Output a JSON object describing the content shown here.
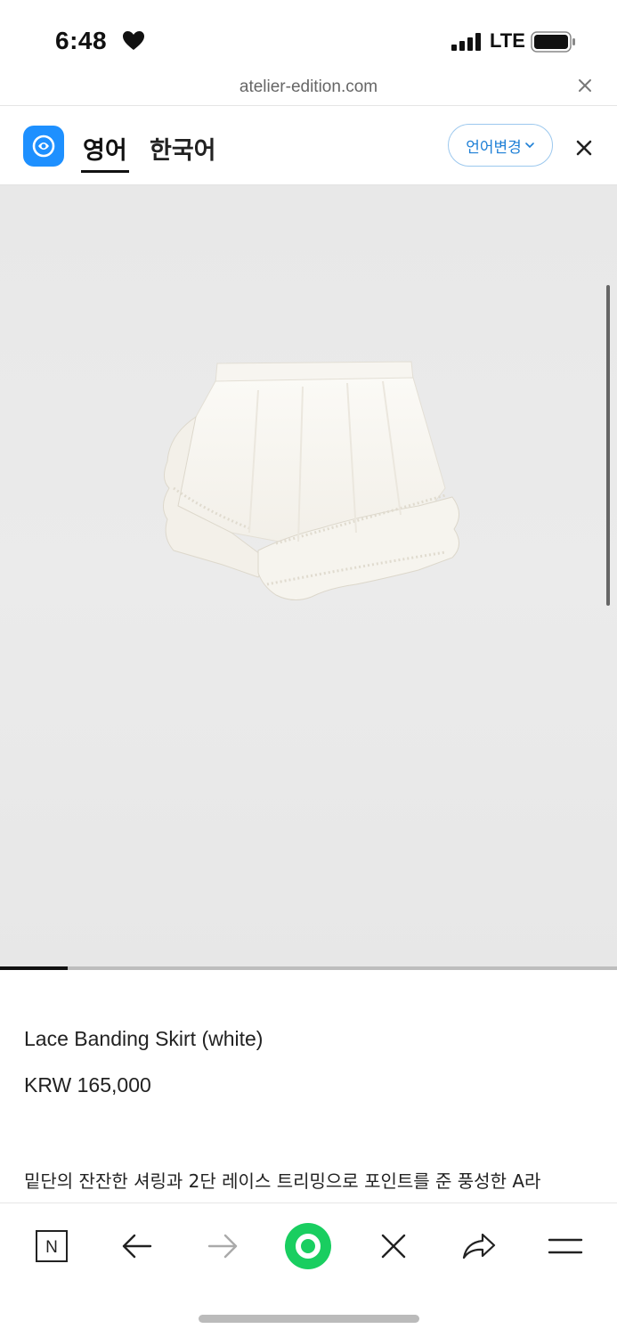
{
  "status_bar": {
    "time": "6:48",
    "network": "LTE",
    "heart_icon": "heart-icon",
    "signal_icon": "signal-icon",
    "battery_icon": "battery-icon"
  },
  "browser": {
    "url": "atelier-edition.com",
    "close_icon": "close-icon"
  },
  "translate_bar": {
    "logo_icon": "papago-icon",
    "source_lang": "영어",
    "target_lang": "한국어",
    "change_lang_label": "언어변경",
    "chevron_icon": "chevron-down-icon",
    "close_icon": "close-icon"
  },
  "gallery": {
    "progress": 0.11,
    "image_description_icon": "product-image"
  },
  "product": {
    "name": "Lace Banding Skirt (white)",
    "price": "KRW 165,000",
    "description": "밑단의 잔잔한 셔링과 2단 레이스 트리밍으로 포인트를 준 풍성한 A라"
  },
  "toolbar": {
    "items": [
      {
        "icon": "naver-icon"
      },
      {
        "icon": "back-arrow-icon"
      },
      {
        "icon": "forward-arrow-icon"
      },
      {
        "icon": "green-dot-icon"
      },
      {
        "icon": "close-icon"
      },
      {
        "icon": "share-icon"
      },
      {
        "icon": "menu-icon"
      }
    ]
  },
  "colors": {
    "accent_blue": "#1e90ff",
    "lang_button_text": "#1d7fd6",
    "green": "#19ce60",
    "image_bg": "#e9e9e9"
  }
}
